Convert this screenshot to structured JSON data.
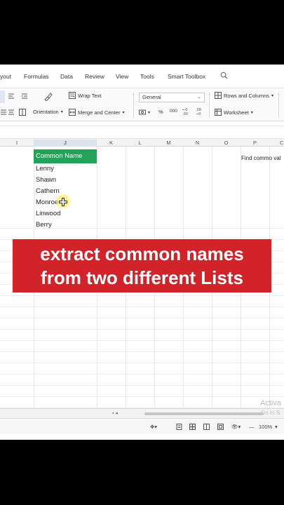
{
  "menu": {
    "items": [
      "yout",
      "Formulas",
      "Data",
      "Review",
      "View",
      "Tools",
      "Smart Toolbox"
    ]
  },
  "ribbon": {
    "wrap_text": "Wrap Text",
    "orientation": "Orientation",
    "merge_center": "Merge and Center",
    "number_format": "General",
    "rows_columns": "Rows and Columns",
    "worksheet": "Worksheet",
    "percent": "%",
    "thousands": "000"
  },
  "columns": [
    "I",
    "J",
    "K",
    "L",
    "M",
    "N",
    "O",
    "P",
    "C"
  ],
  "sheet": {
    "header": "Common Name",
    "names": [
      "Lenny",
      "Shawn",
      "Cathern",
      "Monroe",
      "Linwood",
      "Berry"
    ],
    "note": "Find commo val"
  },
  "status": {
    "zoom": "100%"
  },
  "watermark": {
    "line1": "Activa",
    "line2": "Go to S"
  },
  "caption": {
    "line1": "extract common names",
    "line2": "from two different Lists"
  },
  "colors": {
    "header_green": "#22a35a",
    "caption_red": "#d2232a"
  }
}
